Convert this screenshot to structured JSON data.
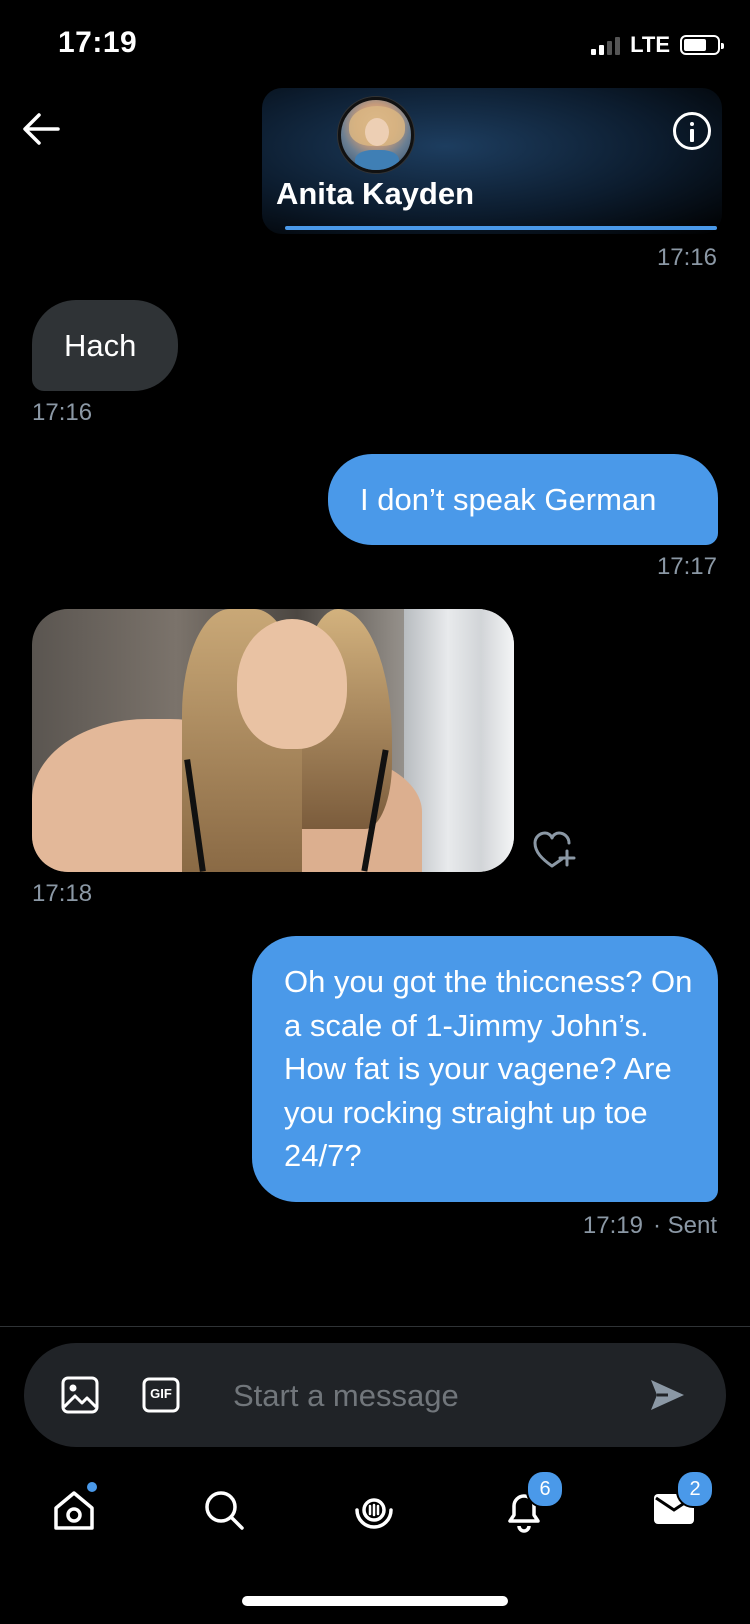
{
  "status_bar": {
    "time": "17:19",
    "network": "LTE"
  },
  "header": {
    "contact_name": "Anita Kayden"
  },
  "messages": [
    {
      "id": "m0",
      "direction": "out",
      "time": "17:16"
    },
    {
      "id": "m1",
      "direction": "in",
      "text": "Hach",
      "time": "17:16"
    },
    {
      "id": "m2",
      "direction": "out",
      "text": "I don’t speak German",
      "time": "17:17"
    },
    {
      "id": "m3",
      "direction": "in",
      "type": "image",
      "time": "17:18"
    },
    {
      "id": "m4",
      "direction": "out",
      "text": "Oh you got the thiccness? On a scale of 1-Jimmy John’s. How fat is your vagene? Are you rocking straight up toe 24/7?",
      "time": "17:19",
      "status": "· Sent"
    }
  ],
  "composer": {
    "placeholder": "Start a message",
    "gif_label": "GIF"
  },
  "tab_bar": {
    "notifications_badge": "6",
    "messages_badge": "2"
  },
  "colors": {
    "accent": "#4a99e9",
    "incoming_bubble": "#2f3336",
    "background": "#000000"
  }
}
